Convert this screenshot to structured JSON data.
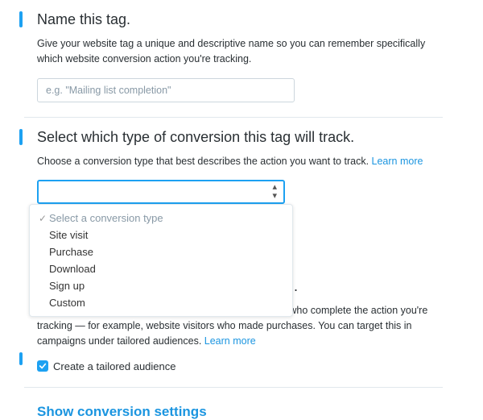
{
  "name_section": {
    "title": "Name this tag.",
    "desc": "Give your website tag a unique and descriptive name so you can remember specifically which website conversion action you're tracking.",
    "placeholder": "e.g. \"Mailing list completion\""
  },
  "type_section": {
    "title": "Select which type of conversion this tag will track.",
    "desc": "Choose a conversion type that best describes the action you want to track. ",
    "learn_more": "Learn more",
    "options": {
      "placeholder": "Select a conversion type",
      "o1": "Site visit",
      "o2": "Purchase",
      "o3": "Download",
      "o4": "Sign up",
      "o5": "Custom"
    }
  },
  "audience_section": {
    "title_tail": "eting.",
    "desc": "Create a tailored audience composed of website visitors who complete the action you're tracking — for example, website visitors who made purchases. You can target this in campaigns under tailored audiences. ",
    "learn_more": "Learn more",
    "checkbox_label": "Create a tailored audience"
  },
  "show_settings": "Show conversion settings"
}
